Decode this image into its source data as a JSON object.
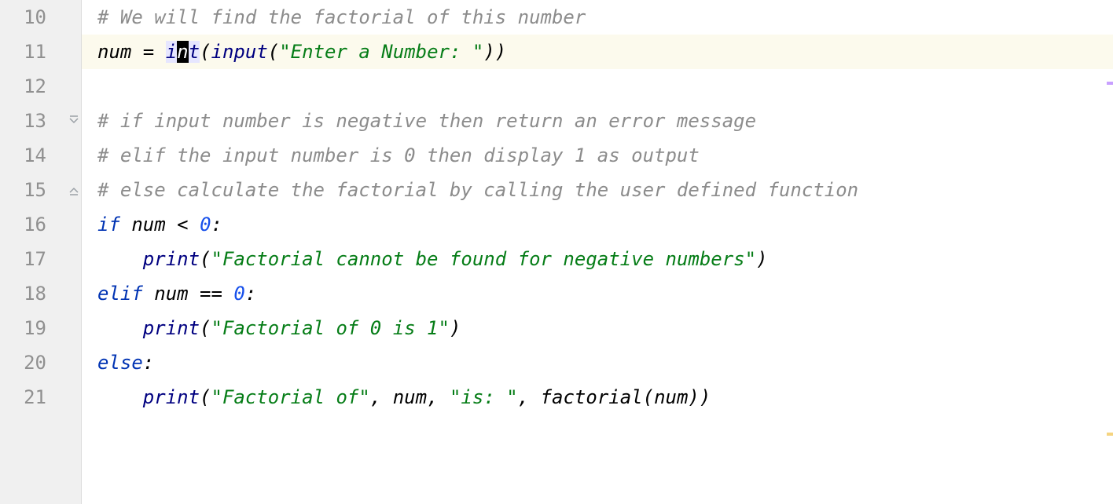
{
  "lines": {
    "10": {
      "num": "10",
      "comment": "# We will find the factorial of this number"
    },
    "11": {
      "num": "11",
      "ident": "num",
      "op": " = ",
      "int_i": "i",
      "int_n": "n",
      "int_t": "t",
      "p1": "(",
      "input": "input",
      "p2": "(",
      "str": "\"Enter a Number: \"",
      "p3": "))"
    },
    "12": {
      "num": "12"
    },
    "13": {
      "num": "13",
      "comment": "# if input number is negative then return an error message"
    },
    "14": {
      "num": "14",
      "comment": "# elif the input number is 0 then display 1 as output"
    },
    "15": {
      "num": "15",
      "comment": "# else calculate the factorial by calling the user defined function"
    },
    "16": {
      "num": "16",
      "kw": "if ",
      "ident": "num < ",
      "zero": "0",
      "colon": ":"
    },
    "17": {
      "num": "17",
      "indent": "    ",
      "print": "print",
      "p1": "(",
      "str": "\"Factorial cannot be found for negative numbers\"",
      "p2": ")"
    },
    "18": {
      "num": "18",
      "kw": "elif ",
      "ident": "num == ",
      "zero": "0",
      "colon": ":"
    },
    "19": {
      "num": "19",
      "indent": "    ",
      "print": "print",
      "p1": "(",
      "str": "\"Factorial of 0 is 1\"",
      "p2": ")"
    },
    "20": {
      "num": "20",
      "kw": "else",
      "colon": ":"
    },
    "21": {
      "num": "21",
      "indent": "    ",
      "print": "print",
      "p1": "(",
      "str1": "\"Factorial of\"",
      "c1": ", ",
      "id1": "num",
      "c2": ", ",
      "str2": "\"is: \"",
      "c3": ", ",
      "call": "factorial(num))"
    }
  }
}
